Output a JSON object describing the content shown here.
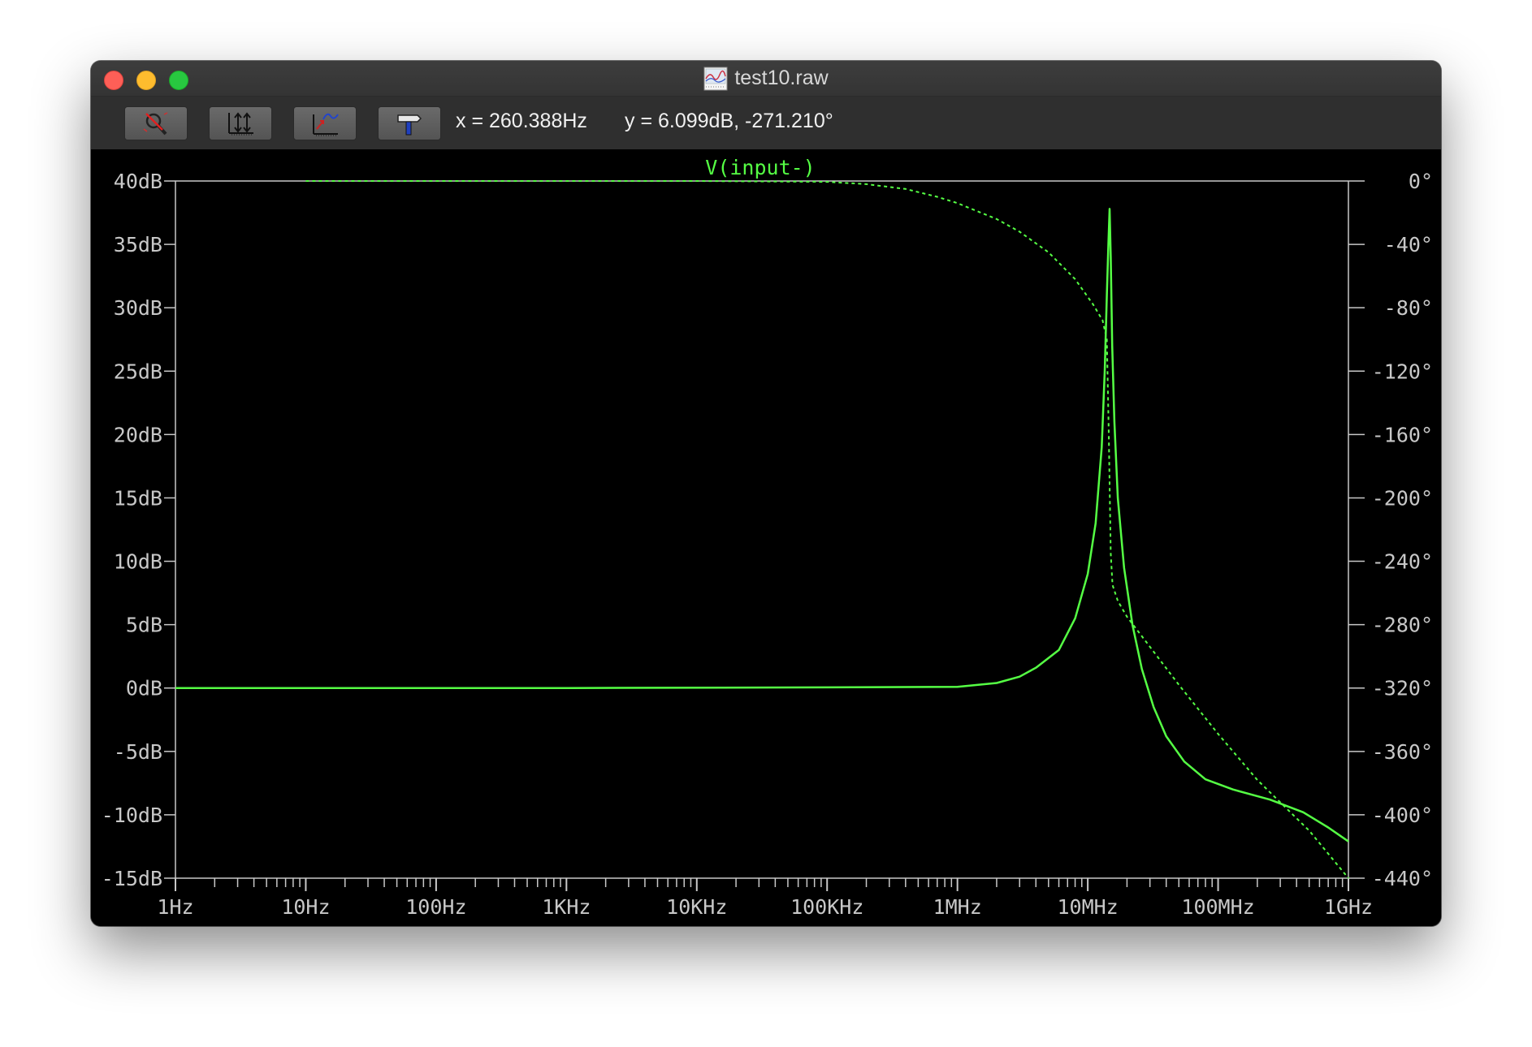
{
  "window": {
    "title": "test10.raw"
  },
  "toolbar": {
    "buttons": [
      {
        "name": "zoom-cancel-button",
        "icon": "magnifier-cancel-icon"
      },
      {
        "name": "autorange-y-button",
        "icon": "autorange-y-icon"
      },
      {
        "name": "autorange-x-button",
        "icon": "autorange-x-icon"
      },
      {
        "name": "settings-button",
        "icon": "hammer-icon"
      }
    ],
    "cursor_x": "x = 260.388Hz",
    "cursor_y": "y = 6.099dB, -271.210°"
  },
  "chart_data": {
    "type": "line",
    "title": "V(input-)",
    "x_scale": "log",
    "xlim_hz": [
      1,
      1000000000
    ],
    "x_tick_labels": [
      "1Hz",
      "10Hz",
      "100Hz",
      "1KHz",
      "10KHz",
      "100KHz",
      "1MHz",
      "10MHz",
      "100MHz",
      "1GHz"
    ],
    "left_axis": {
      "ylim": [
        -15,
        40
      ],
      "unit": "dB",
      "tick_labels": [
        "40dB",
        "35dB",
        "30dB",
        "25dB",
        "20dB",
        "15dB",
        "10dB",
        "5dB",
        "0dB",
        "-5dB",
        "-10dB",
        "-15dB"
      ]
    },
    "right_axis": {
      "ylim": [
        -440,
        0
      ],
      "unit": "°",
      "tick_labels": [
        "0°",
        "-40°",
        "-80°",
        "-120°",
        "-160°",
        "-200°",
        "-240°",
        "-280°",
        "-320°",
        "-360°",
        "-400°",
        "-440°"
      ]
    },
    "series": [
      {
        "style": "solid",
        "axis": "left",
        "color": "#55ff44",
        "points": [
          [
            1,
            0
          ],
          [
            1000,
            0
          ],
          [
            100000,
            0.05
          ],
          [
            1000000,
            0.1
          ],
          [
            2000000,
            0.4
          ],
          [
            3000000,
            0.9
          ],
          [
            4000000,
            1.6
          ],
          [
            6000000,
            3.0
          ],
          [
            8000000,
            5.5
          ],
          [
            10000000,
            9.0
          ],
          [
            11500000,
            13.0
          ],
          [
            12800000,
            19.0
          ],
          [
            13500000,
            25.0
          ],
          [
            14000000,
            31.0
          ],
          [
            14400000,
            35.0
          ],
          [
            14700000,
            37.8
          ],
          [
            15000000,
            34.0
          ],
          [
            15400000,
            27.0
          ],
          [
            16000000,
            21.0
          ],
          [
            17000000,
            15.0
          ],
          [
            19000000,
            9.5
          ],
          [
            22000000,
            5.0
          ],
          [
            26000000,
            1.5
          ],
          [
            32000000,
            -1.5
          ],
          [
            40000000,
            -3.8
          ],
          [
            55000000,
            -5.8
          ],
          [
            80000000,
            -7.2
          ],
          [
            130000000,
            -8.0
          ],
          [
            250000000,
            -8.8
          ],
          [
            450000000,
            -9.8
          ],
          [
            700000000,
            -11.0
          ],
          [
            1000000000,
            -12.1
          ]
        ]
      },
      {
        "style": "dashed",
        "axis": "right",
        "color": "#55ff44",
        "points": [
          [
            10,
            0
          ],
          [
            10000,
            0
          ],
          [
            100000,
            -0.5
          ],
          [
            200000,
            -2
          ],
          [
            400000,
            -5
          ],
          [
            700000,
            -10
          ],
          [
            1000000,
            -14
          ],
          [
            2000000,
            -24
          ],
          [
            3000000,
            -32
          ],
          [
            5000000,
            -45
          ],
          [
            8000000,
            -62
          ],
          [
            11000000,
            -78
          ],
          [
            13000000,
            -88
          ],
          [
            14000000,
            -100
          ],
          [
            14500000,
            -160
          ],
          [
            15000000,
            -235
          ],
          [
            15500000,
            -255
          ],
          [
            17000000,
            -265
          ],
          [
            20000000,
            -275
          ],
          [
            30000000,
            -294
          ],
          [
            50000000,
            -318
          ],
          [
            100000000,
            -349
          ],
          [
            200000000,
            -378
          ],
          [
            500000000,
            -410
          ],
          [
            1000000000,
            -440
          ]
        ]
      }
    ],
    "grid": false,
    "background": "#000000",
    "axis_color": "#c8c8c8",
    "title_color": "#55ff44"
  }
}
